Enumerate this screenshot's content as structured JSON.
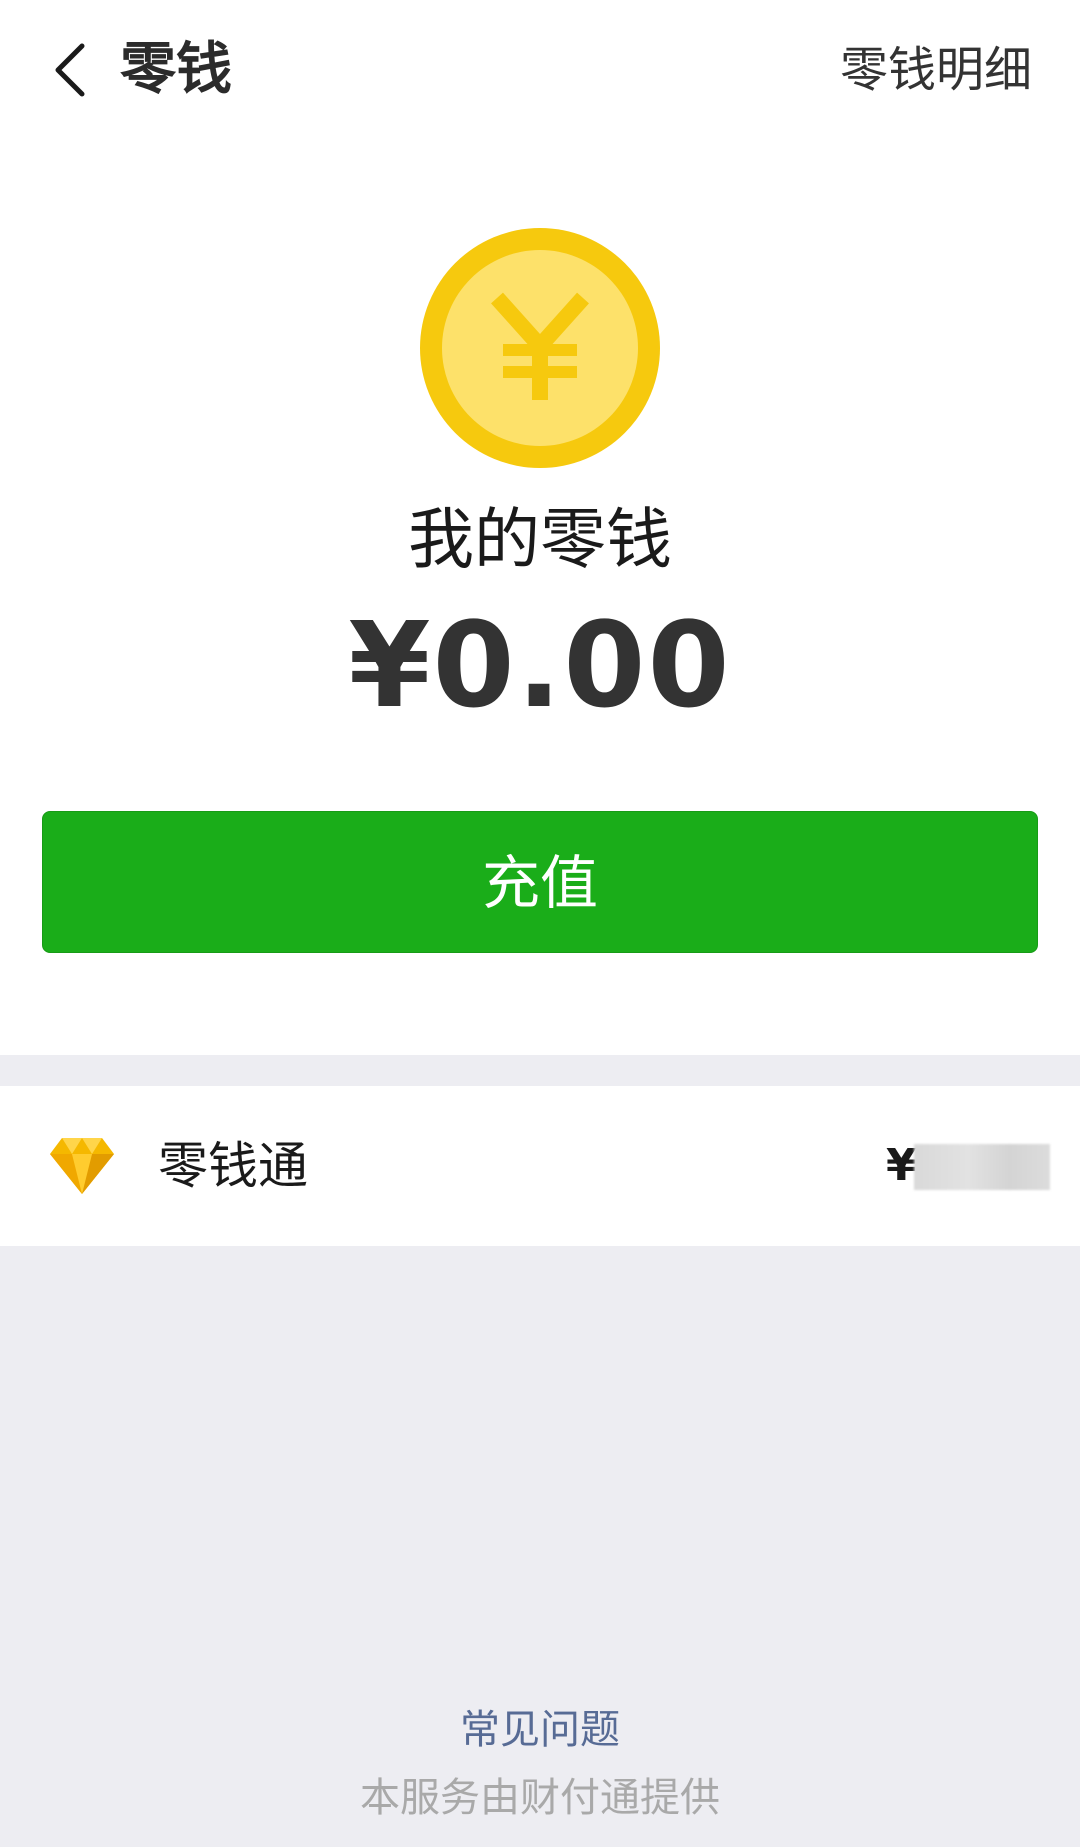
{
  "nav": {
    "back_icon": "chevron-left-icon",
    "title": "零钱",
    "action_label": "零钱明细"
  },
  "wallet": {
    "coin_icon": "yuan-coin-icon",
    "coin_symbol": "¥",
    "balance_label": "我的零钱",
    "balance_amount": "¥0.00",
    "recharge_label": "充值"
  },
  "lingqiantong": {
    "icon": "diamond-icon",
    "label": "零钱通",
    "currency_symbol": "¥"
  },
  "footer": {
    "faq_label": "常见问题",
    "provider_text": "本服务由财付通提供"
  },
  "colors": {
    "brand_green": "#1aad19",
    "coin_gold": "#f6c90e",
    "coin_light": "#fde16a",
    "link_blue": "#576b95",
    "page_background": "#ededf2"
  }
}
